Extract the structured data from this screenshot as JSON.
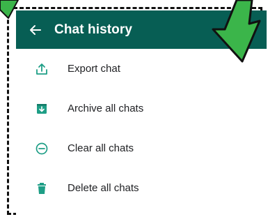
{
  "header": {
    "title": "Chat history",
    "back_icon": "arrow-left-icon",
    "color": "#075e54"
  },
  "menu": [
    {
      "label": "Export chat",
      "icon": "export-icon"
    },
    {
      "label": "Archive all chats",
      "icon": "archive-icon"
    },
    {
      "label": "Clear all chats",
      "icon": "clear-icon"
    },
    {
      "label": "Delete all chats",
      "icon": "delete-icon"
    }
  ],
  "theme": {
    "icon_color": "#1e9e86",
    "annotation_arrow": "#3bb54a"
  }
}
